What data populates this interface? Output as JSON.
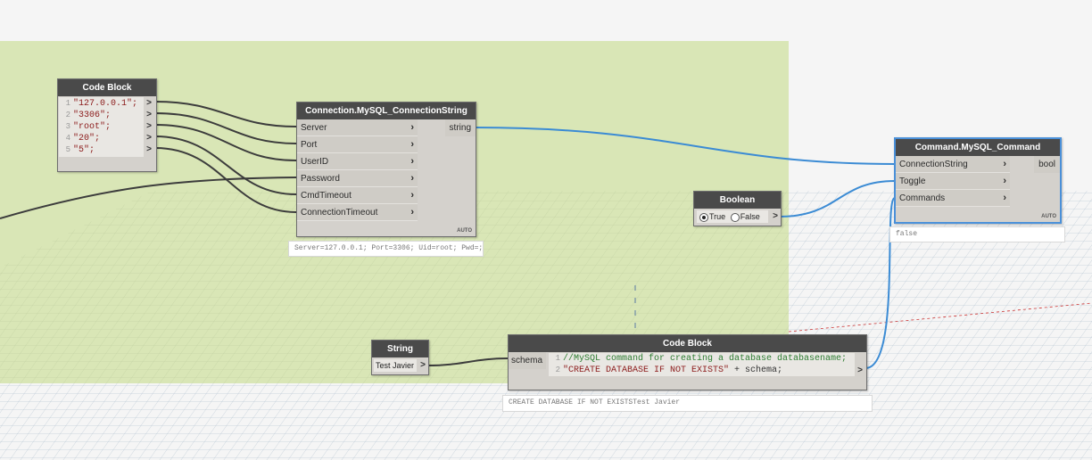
{
  "colors": {
    "group_bg": "#d9e6b6",
    "wire_dark": "#3c3c3c",
    "wire_blue": "#3b8bd4",
    "node_header": "#4a4a4a"
  },
  "code_block_1": {
    "title": "Code Block",
    "lines": [
      {
        "num": "1",
        "text": "\"127.0.0.1\";"
      },
      {
        "num": "2",
        "text": "\"3306\";"
      },
      {
        "num": "3",
        "text": "\"root\";"
      },
      {
        "num": "4",
        "text": "\"20\";"
      },
      {
        "num": "5",
        "text": "\"5\";"
      }
    ],
    "out_arrow": ">"
  },
  "connection_node": {
    "title": "Connection.MySQL_ConnectionString",
    "inputs": [
      "Server",
      "Port",
      "UserID",
      "Password",
      "CmdTimeout",
      "ConnectionTimeout"
    ],
    "output": "string",
    "lacing": "AUTO",
    "preview": "Server=127.0.0.1; Port=3306; Uid=root; Pwd=;"
  },
  "command_node": {
    "title": "Command.MySQL_Command",
    "inputs": [
      "ConnectionString",
      "Toggle",
      "Commands"
    ],
    "output": "bool",
    "lacing": "AUTO",
    "preview": "false"
  },
  "boolean_node": {
    "title": "Boolean",
    "true_label": "True",
    "false_label": "False",
    "selected": "True",
    "out_arrow": ">"
  },
  "string_node": {
    "title": "String",
    "value": "Test Javier",
    "out_arrow": ">"
  },
  "code_block_2": {
    "title": "Code Block",
    "input": "schema",
    "line1_num": "1",
    "line1": "//MySQL command for creating a database databasename;",
    "line2_num": "2",
    "line2_str": "\"CREATE DATABASE IF NOT EXISTS\"",
    "line2_rest": " + schema;",
    "out_arrow": ">",
    "preview": "CREATE DATABASE IF NOT EXISTSTest Javier"
  }
}
